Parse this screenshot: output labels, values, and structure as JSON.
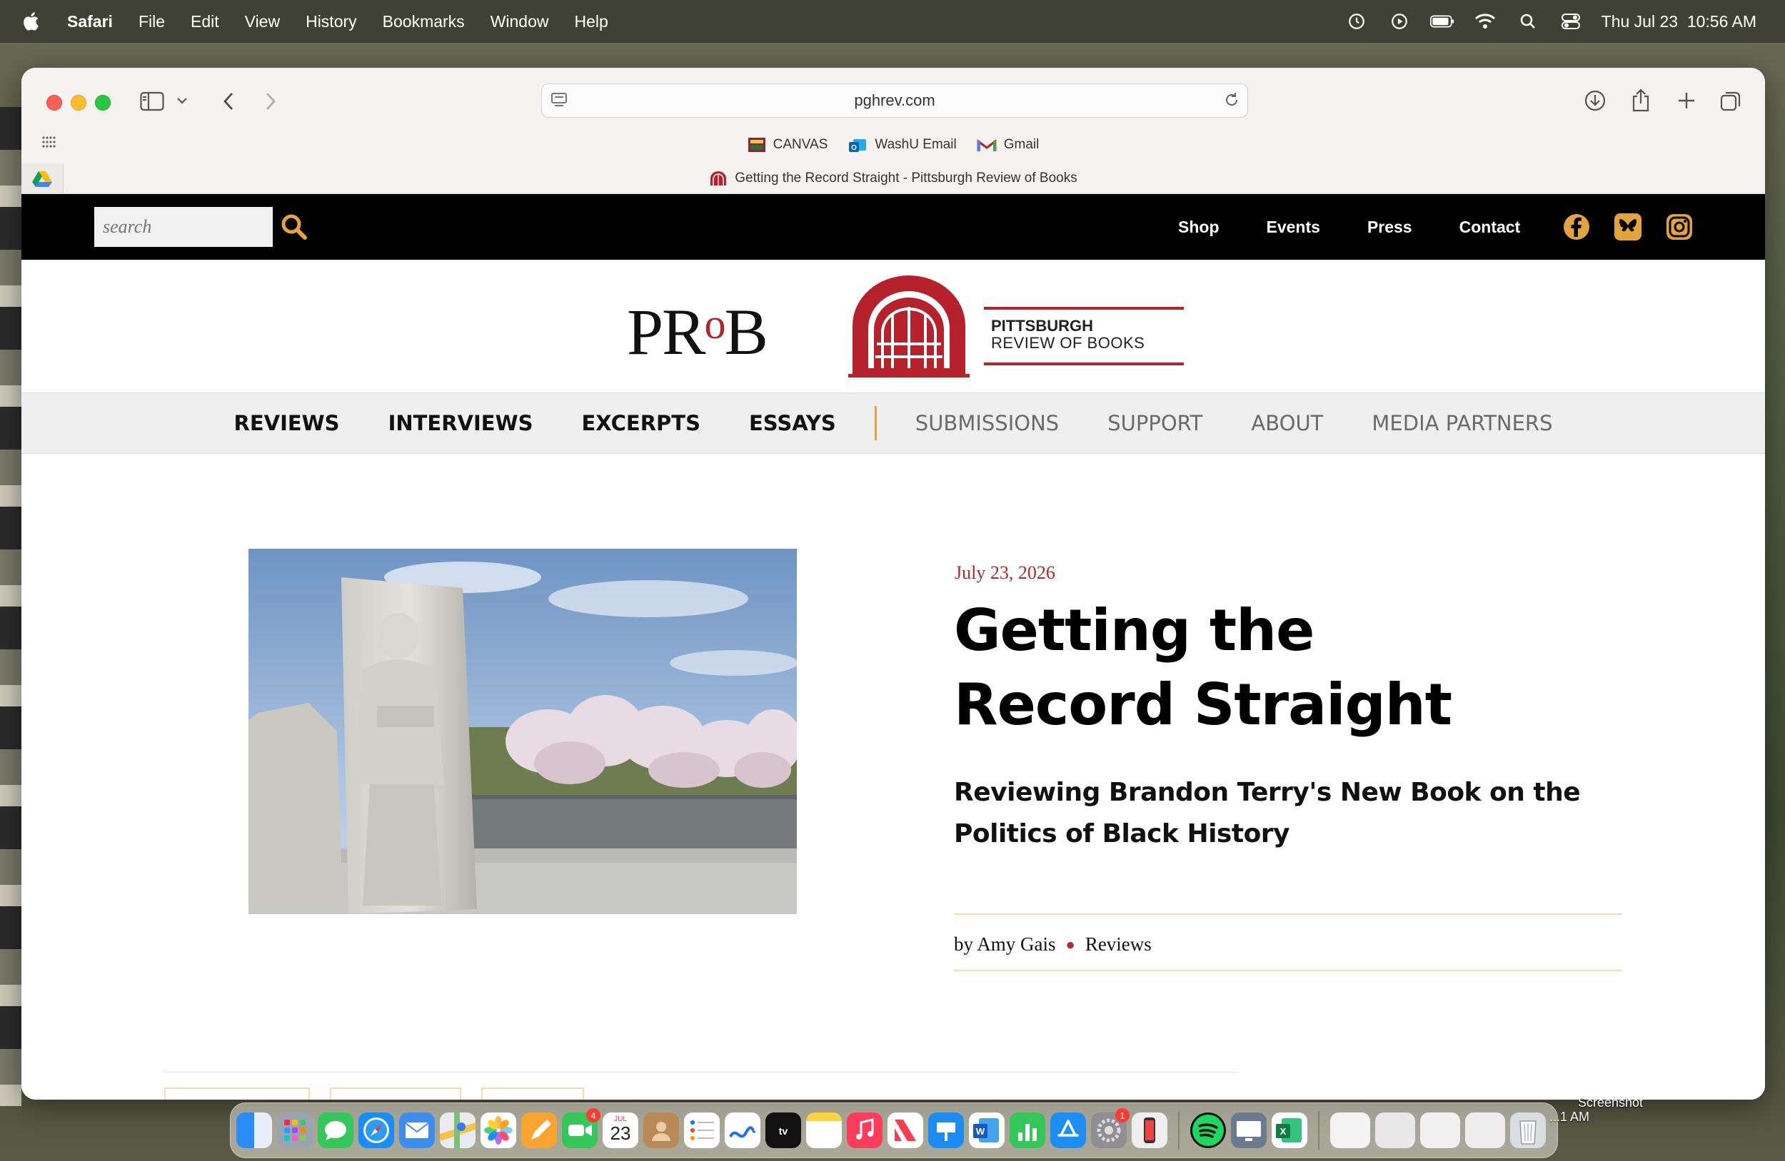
{
  "menubar": {
    "app": "Safari",
    "items": [
      "File",
      "Edit",
      "View",
      "History",
      "Bookmarks",
      "Window",
      "Help"
    ],
    "datetime": "Thu Jul 23  10:56 AM"
  },
  "browser": {
    "url": "pghrev.com",
    "bookmarks": [
      "CANVAS",
      "WashU Email",
      "Gmail"
    ],
    "tab_title": "Getting the Record Straight - Pittsburgh Review of Books"
  },
  "site": {
    "search_placeholder": "search",
    "top_nav": [
      "Shop",
      "Events",
      "Press",
      "Contact"
    ],
    "logo": {
      "p1": "PR",
      "o": "o",
      "p2": "B",
      "line1": "PITTSBURGH",
      "line2": "REVIEW OF BOOKS"
    },
    "main_nav_primary": [
      "REVIEWS",
      "INTERVIEWS",
      "EXCERPTS",
      "ESSAYS"
    ],
    "main_nav_secondary": [
      "SUBMISSIONS",
      "SUPPORT",
      "ABOUT",
      "MEDIA PARTNERS"
    ]
  },
  "article": {
    "date": "July 23, 2026",
    "title": "Getting the Record Straight",
    "subtitle": "Reviewing Brandon Terry's New Book on the Politics of Black History",
    "author": "by Amy Gais",
    "category": "Reviews"
  },
  "dock": {
    "calendar_month": "JUL",
    "calendar_day": "23",
    "facetime_badge": "4",
    "settings_badge": "1",
    "screenshot_label": "Screenshot",
    "screenshot_time": "...1 AM"
  },
  "colors": {
    "accent_gold": "#e3a43b",
    "brand_red": "#b5222b",
    "date_red": "#b22a2a"
  }
}
